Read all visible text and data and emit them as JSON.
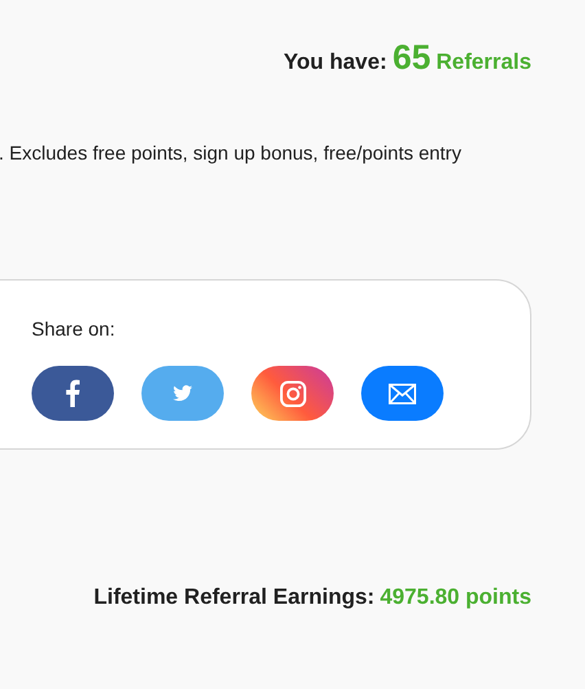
{
  "referrals": {
    "label": "You have:",
    "count": "65",
    "unit": "Referrals"
  },
  "note": ". Excludes free points, sign up bonus, free/points entry",
  "share": {
    "label": "Share on:",
    "buttons": [
      {
        "kind": "facebook"
      },
      {
        "kind": "twitter"
      },
      {
        "kind": "instagram"
      },
      {
        "kind": "email"
      }
    ]
  },
  "earnings": {
    "label": "Lifetime Referral Earnings:",
    "value": "4975.80 points"
  }
}
